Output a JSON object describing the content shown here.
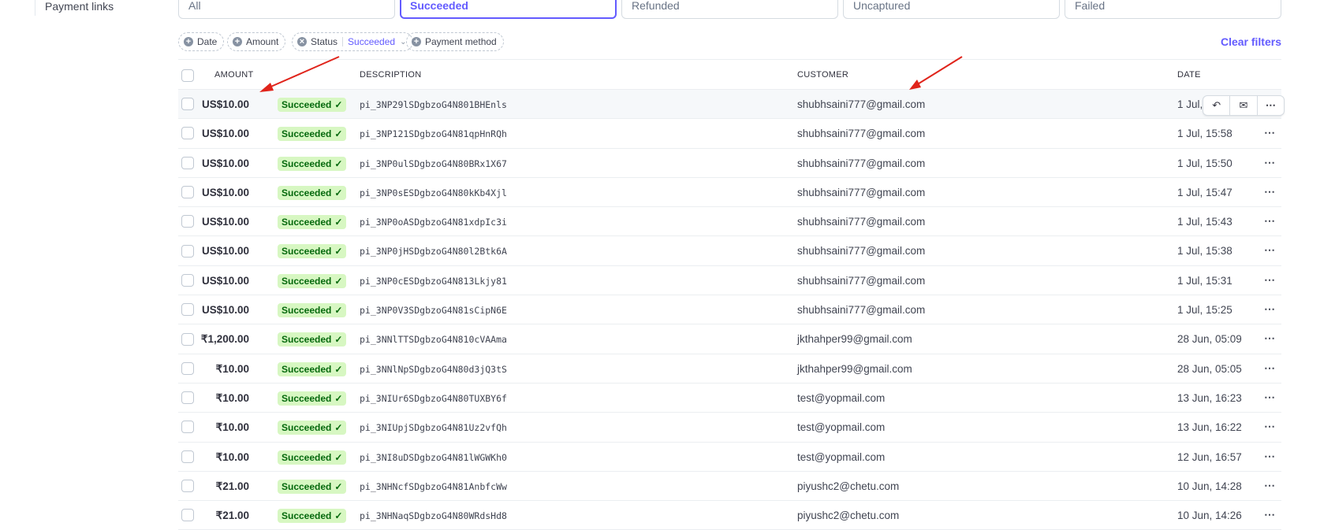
{
  "sidebar": {
    "payment_links": "Payment links"
  },
  "status_tabs": [
    "All",
    "Succeeded",
    "Refunded",
    "Uncaptured",
    "Failed"
  ],
  "filters": {
    "date": "Date",
    "amount": "Amount",
    "status": "Status",
    "status_value": "Succeeded",
    "payment_method": "Payment method",
    "clear": "Clear filters"
  },
  "table": {
    "headers": {
      "amount": "AMOUNT",
      "description": "DESCRIPTION",
      "customer": "CUSTOMER",
      "date": "DATE"
    },
    "rows": [
      {
        "amount": "US$10.00",
        "status": "Succeeded",
        "description": "pi_3NP29lSDgbzoG4N801BHEnls",
        "customer": "shubhsaini777@gmail.com",
        "date": "1 Jul,"
      },
      {
        "amount": "US$10.00",
        "status": "Succeeded",
        "description": "pi_3NP121SDgbzoG4N81qpHnRQh",
        "customer": "shubhsaini777@gmail.com",
        "date": "1 Jul, 15:58"
      },
      {
        "amount": "US$10.00",
        "status": "Succeeded",
        "description": "pi_3NP0ulSDgbzoG4N80BRx1X67",
        "customer": "shubhsaini777@gmail.com",
        "date": "1 Jul, 15:50"
      },
      {
        "amount": "US$10.00",
        "status": "Succeeded",
        "description": "pi_3NP0sESDgbzoG4N80kKb4Xjl",
        "customer": "shubhsaini777@gmail.com",
        "date": "1 Jul, 15:47"
      },
      {
        "amount": "US$10.00",
        "status": "Succeeded",
        "description": "pi_3NP0oASDgbzoG4N81xdpIc3i",
        "customer": "shubhsaini777@gmail.com",
        "date": "1 Jul, 15:43"
      },
      {
        "amount": "US$10.00",
        "status": "Succeeded",
        "description": "pi_3NP0jHSDgbzoG4N80l2Btk6A",
        "customer": "shubhsaini777@gmail.com",
        "date": "1 Jul, 15:38"
      },
      {
        "amount": "US$10.00",
        "status": "Succeeded",
        "description": "pi_3NP0cESDgbzoG4N813Lkjy81",
        "customer": "shubhsaini777@gmail.com",
        "date": "1 Jul, 15:31"
      },
      {
        "amount": "US$10.00",
        "status": "Succeeded",
        "description": "pi_3NP0V3SDgbzoG4N81sCipN6E",
        "customer": "shubhsaini777@gmail.com",
        "date": "1 Jul, 15:25"
      },
      {
        "amount": "₹1,200.00",
        "status": "Succeeded",
        "description": "pi_3NNlTTSDgbzoG4N810cVAAma",
        "customer": "jkthahper99@gmail.com",
        "date": "28 Jun, 05:09"
      },
      {
        "amount": "₹10.00",
        "status": "Succeeded",
        "description": "pi_3NNlNpSDgbzoG4N80d3jQ3tS",
        "customer": "jkthahper99@gmail.com",
        "date": "28 Jun, 05:05"
      },
      {
        "amount": "₹10.00",
        "status": "Succeeded",
        "description": "pi_3NIUr6SDgbzoG4N80TUXBY6f",
        "customer": "test@yopmail.com",
        "date": "13 Jun, 16:23"
      },
      {
        "amount": "₹10.00",
        "status": "Succeeded",
        "description": "pi_3NIUpjSDgbzoG4N81Uz2vfQh",
        "customer": "test@yopmail.com",
        "date": "13 Jun, 16:22"
      },
      {
        "amount": "₹10.00",
        "status": "Succeeded",
        "description": "pi_3NI8uDSDgbzoG4N81lWGWKh0",
        "customer": "test@yopmail.com",
        "date": "12 Jun, 16:57"
      },
      {
        "amount": "₹21.00",
        "status": "Succeeded",
        "description": "pi_3NHNcfSDgbzoG4N81AnbfcWw",
        "customer": "piyushc2@chetu.com",
        "date": "10 Jun, 14:28"
      },
      {
        "amount": "₹21.00",
        "status": "Succeeded",
        "description": "pi_3NHNaqSDgbzoG4N80WRdsHd8",
        "customer": "piyushc2@chetu.com",
        "date": "10 Jun, 14:26"
      }
    ]
  },
  "icons": {
    "pill_add": "+",
    "pill_remove": "×",
    "chevron": "⌄",
    "check": "✓",
    "refund": "↶",
    "email": "✉",
    "more": "⋯"
  },
  "colors": {
    "accent": "#635bff",
    "success_bg": "#d7f7c2",
    "success_text": "#05690d",
    "annotation": "#e0241b"
  }
}
